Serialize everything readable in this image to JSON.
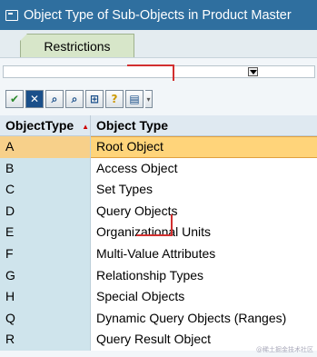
{
  "window": {
    "title": "Object Type of Sub-Objects in Product Master"
  },
  "tabs": [
    {
      "label": "Restrictions"
    }
  ],
  "toolbar": {
    "buttons": [
      {
        "name": "continue-button",
        "icon": "checkmark-icon",
        "glyph": "✔"
      },
      {
        "name": "cancel-button",
        "icon": "close-icon",
        "glyph": "✕"
      },
      {
        "name": "find-button",
        "icon": "binoculars-icon",
        "glyph": "⌕"
      },
      {
        "name": "find-next-button",
        "icon": "binoculars-plus-icon",
        "glyph": "⌕"
      },
      {
        "name": "sort-button",
        "icon": "sort-icon",
        "glyph": "⊞"
      },
      {
        "name": "help-button",
        "icon": "help-icon",
        "glyph": "?"
      },
      {
        "name": "print-button",
        "icon": "print-icon",
        "glyph": "▤"
      }
    ]
  },
  "table": {
    "columns": [
      "ObjectType",
      "Object Type"
    ],
    "rows": [
      {
        "code": "A",
        "label": "Root Object",
        "selected": true
      },
      {
        "code": "B",
        "label": "Access Object"
      },
      {
        "code": "C",
        "label": "Set Types"
      },
      {
        "code": "D",
        "label": "Query Objects"
      },
      {
        "code": "E",
        "label": "Organizational Units"
      },
      {
        "code": "F",
        "label": "Multi-Value Attributes"
      },
      {
        "code": "G",
        "label": "Relationship Types"
      },
      {
        "code": "H",
        "label": "Special Objects"
      },
      {
        "code": "Q",
        "label": "Dynamic Query Objects (Ranges)"
      },
      {
        "code": "R",
        "label": "Query Result Object"
      }
    ]
  },
  "watermark": "@稀土掘金技术社区"
}
